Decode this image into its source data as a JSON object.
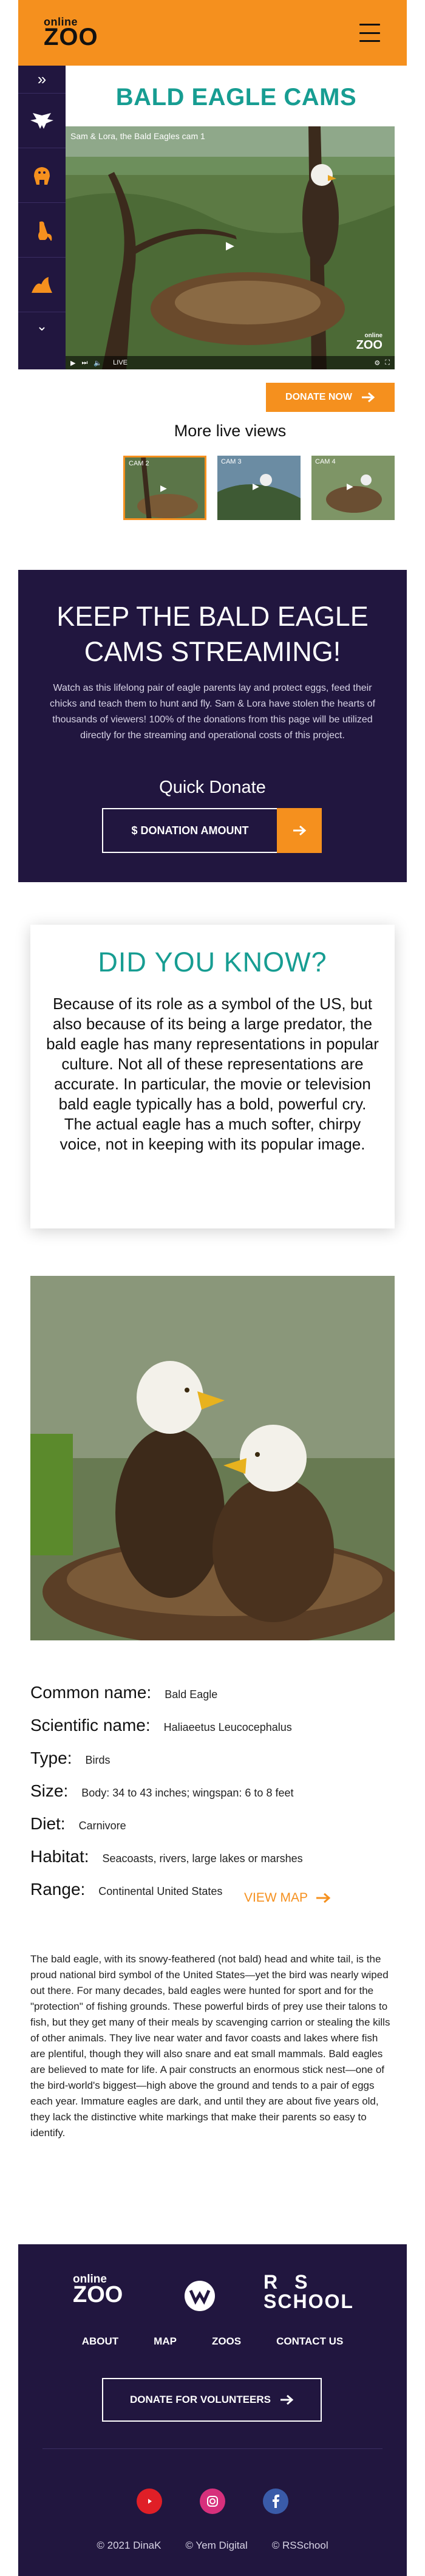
{
  "header": {
    "logo_small": "online",
    "logo_big": "ZOO"
  },
  "side_nav": {
    "items": [
      "eagle-icon",
      "gorilla-icon",
      "lemur-icon",
      "alligator-icon"
    ]
  },
  "cam": {
    "title": "BALD EAGLE CAMS",
    "video_caption": "Sam & Lora, the Bald Eagles cam 1",
    "brand_small": "online",
    "brand_big": "ZOO",
    "live_label": "LIVE"
  },
  "donate_now": {
    "label": "DONATE NOW"
  },
  "more_live": {
    "title": "More live views",
    "thumbs": [
      "CAM 2",
      "CAM 3",
      "CAM 4"
    ]
  },
  "keep_streaming": {
    "title": "KEEP THE BALD EAGLE CAMS STREAMING!",
    "text": "Watch as this lifelong pair of eagle parents lay and protect eggs, feed their chicks and teach them to hunt and fly. Sam & Lora have stolen the hearts of thousands of viewers! 100% of the donations from this page will be utilized directly for the streaming and operational costs of this project.",
    "quick_donate": "Quick Donate",
    "amount_placeholder": "$ DONATION AMOUNT"
  },
  "did_you_know": {
    "title": "DID YOU KNOW?",
    "text": "Because of its role as a symbol of the US, but also because of its being a large predator, the bald eagle has many representations in popular culture. Not all of these representations are accurate. In particular, the movie or television bald eagle typically has a bold, powerful cry. The actual eagle has a much softer, chirpy voice, not in keeping with its popular image."
  },
  "facts": [
    {
      "key": "Common name:",
      "value": "Bald Eagle"
    },
    {
      "key": "Scientific name:",
      "value": "Haliaeetus Leucocephalus"
    },
    {
      "key": "Type:",
      "value": "Birds"
    },
    {
      "key": "Size:",
      "value": "Body: 34 to 43 inches; wingspan: 6 to 8 feet"
    },
    {
      "key": "Diet:",
      "value": "Carnivore"
    },
    {
      "key": "Habitat:",
      "value": "Seacoasts, rivers, large lakes or marshes"
    },
    {
      "key": "Range:",
      "value": "Continental United States"
    }
  ],
  "view_map": "VIEW MAP",
  "description": "The bald eagle, with its snowy-feathered (not bald) head and white tail, is the proud national bird symbol of the United States—yet the bird was nearly wiped out there. For many decades, bald eagles were hunted for sport and for the \"protection\" of fishing grounds.  These powerful birds of prey use their talons to fish, but they get many of their meals by scavenging carrion or stealing the kills of other animals. They live near water and favor coasts and lakes where fish are plentiful, though they will also snare and eat small mammals. Bald eagles are believed to mate for life. A pair constructs an enormous stick nest—one of the bird-world's biggest—high above the ground and tends to a pair of eggs each year. Immature eagles are dark, and until they are about five years old, they lack the distinctive white markings that make their parents so easy to identify.",
  "footer": {
    "logo_small": "online",
    "logo_big": "ZOO",
    "rs_line1": "RS",
    "rs_line2": "SCHOOL",
    "nav": [
      "ABOUT",
      "MAP",
      "ZOOS",
      "CONTACT US"
    ],
    "donate_label": "DONATE FOR VOLUNTEERS",
    "copyright": [
      "© 2021 DinaK",
      "© Yem Digital",
      "© RSSchool"
    ]
  },
  "colors": {
    "accent": "#f5901e",
    "dark": "#21163f",
    "teal": "#179d92"
  }
}
